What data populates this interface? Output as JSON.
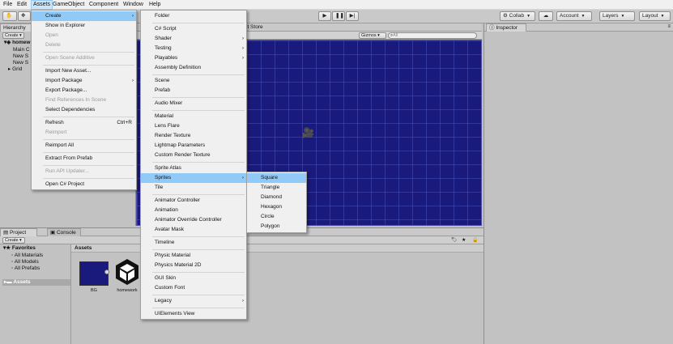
{
  "menubar": {
    "items": [
      "File",
      "Edit",
      "Assets",
      "GameObject",
      "Component",
      "Window",
      "Help"
    ]
  },
  "toolbar": {
    "collab": "Collab",
    "account": "Account",
    "layers": "Layers",
    "layout": "Layout",
    "play_icon": "play-icon",
    "pause_icon": "pause-icon",
    "step_icon": "step-icon",
    "cloud_icon": "cloud-icon"
  },
  "hierarchy": {
    "tab": "Hierarchy",
    "create": "Create",
    "scene_name": "homew",
    "rows": [
      "Main C",
      "New S",
      "New S",
      "Grid"
    ]
  },
  "scene": {
    "tab": "Asset Store",
    "gizmos": "Gizmos",
    "search_placeholder": "All",
    "background_color": "#1a1a7c"
  },
  "inspector": {
    "tab": "Inspector"
  },
  "project": {
    "tab_project": "Project",
    "tab_console": "Console",
    "create": "Create",
    "favorites_title": "Favorites",
    "favorites": [
      "All Materials",
      "All Models",
      "All Prefabs"
    ],
    "assets_root": "Assets",
    "assets_header": "Assets",
    "asset_items": [
      "BG",
      "homework"
    ]
  },
  "assets_menu": {
    "items": [
      {
        "label": "Create",
        "highlight": true,
        "arrow": true
      },
      {
        "label": "Show in Explorer"
      },
      {
        "label": "Open",
        "disabled": true
      },
      {
        "label": "Delete",
        "disabled": true
      },
      {
        "label": "Open Scene Additive",
        "disabled": true
      },
      {
        "label": "Import New Asset..."
      },
      {
        "label": "Import Package",
        "arrow": true
      },
      {
        "label": "Export Package..."
      },
      {
        "label": "Find References In Scene",
        "disabled": true
      },
      {
        "label": "Select Dependencies"
      },
      {
        "label": "Refresh",
        "shortcut": "Ctrl+R"
      },
      {
        "label": "Reimport",
        "disabled": true
      },
      {
        "label": "Reimport All"
      },
      {
        "label": "Extract From Prefab"
      },
      {
        "label": "Run API Updater...",
        "disabled": true
      },
      {
        "label": "Open C# Project"
      }
    ]
  },
  "create_menu": {
    "items": [
      {
        "label": "Folder"
      },
      {
        "label": "C# Script"
      },
      {
        "label": "Shader",
        "arrow": true
      },
      {
        "label": "Testing",
        "arrow": true
      },
      {
        "label": "Playables",
        "arrow": true
      },
      {
        "label": "Assembly Definition"
      },
      {
        "label": "Scene"
      },
      {
        "label": "Prefab"
      },
      {
        "label": "Audio Mixer"
      },
      {
        "label": "Material"
      },
      {
        "label": "Lens Flare"
      },
      {
        "label": "Render Texture"
      },
      {
        "label": "Lightmap Parameters"
      },
      {
        "label": "Custom Render Texture"
      },
      {
        "label": "Sprite Atlas"
      },
      {
        "label": "Sprites",
        "highlight": true,
        "arrow": true
      },
      {
        "label": "Tile"
      },
      {
        "label": "Animator Controller"
      },
      {
        "label": "Animation"
      },
      {
        "label": "Animator Override Controller"
      },
      {
        "label": "Avatar Mask"
      },
      {
        "label": "Timeline"
      },
      {
        "label": "Physic Material"
      },
      {
        "label": "Physics Material 2D"
      },
      {
        "label": "GUI Skin"
      },
      {
        "label": "Custom Font"
      },
      {
        "label": "Legacy",
        "arrow": true
      },
      {
        "label": "UIElements View"
      }
    ]
  },
  "sprites_menu": {
    "items": [
      {
        "label": "Square",
        "highlight": true
      },
      {
        "label": "Triangle"
      },
      {
        "label": "Diamond"
      },
      {
        "label": "Hexagon"
      },
      {
        "label": "Circle"
      },
      {
        "label": "Polygon"
      }
    ]
  }
}
